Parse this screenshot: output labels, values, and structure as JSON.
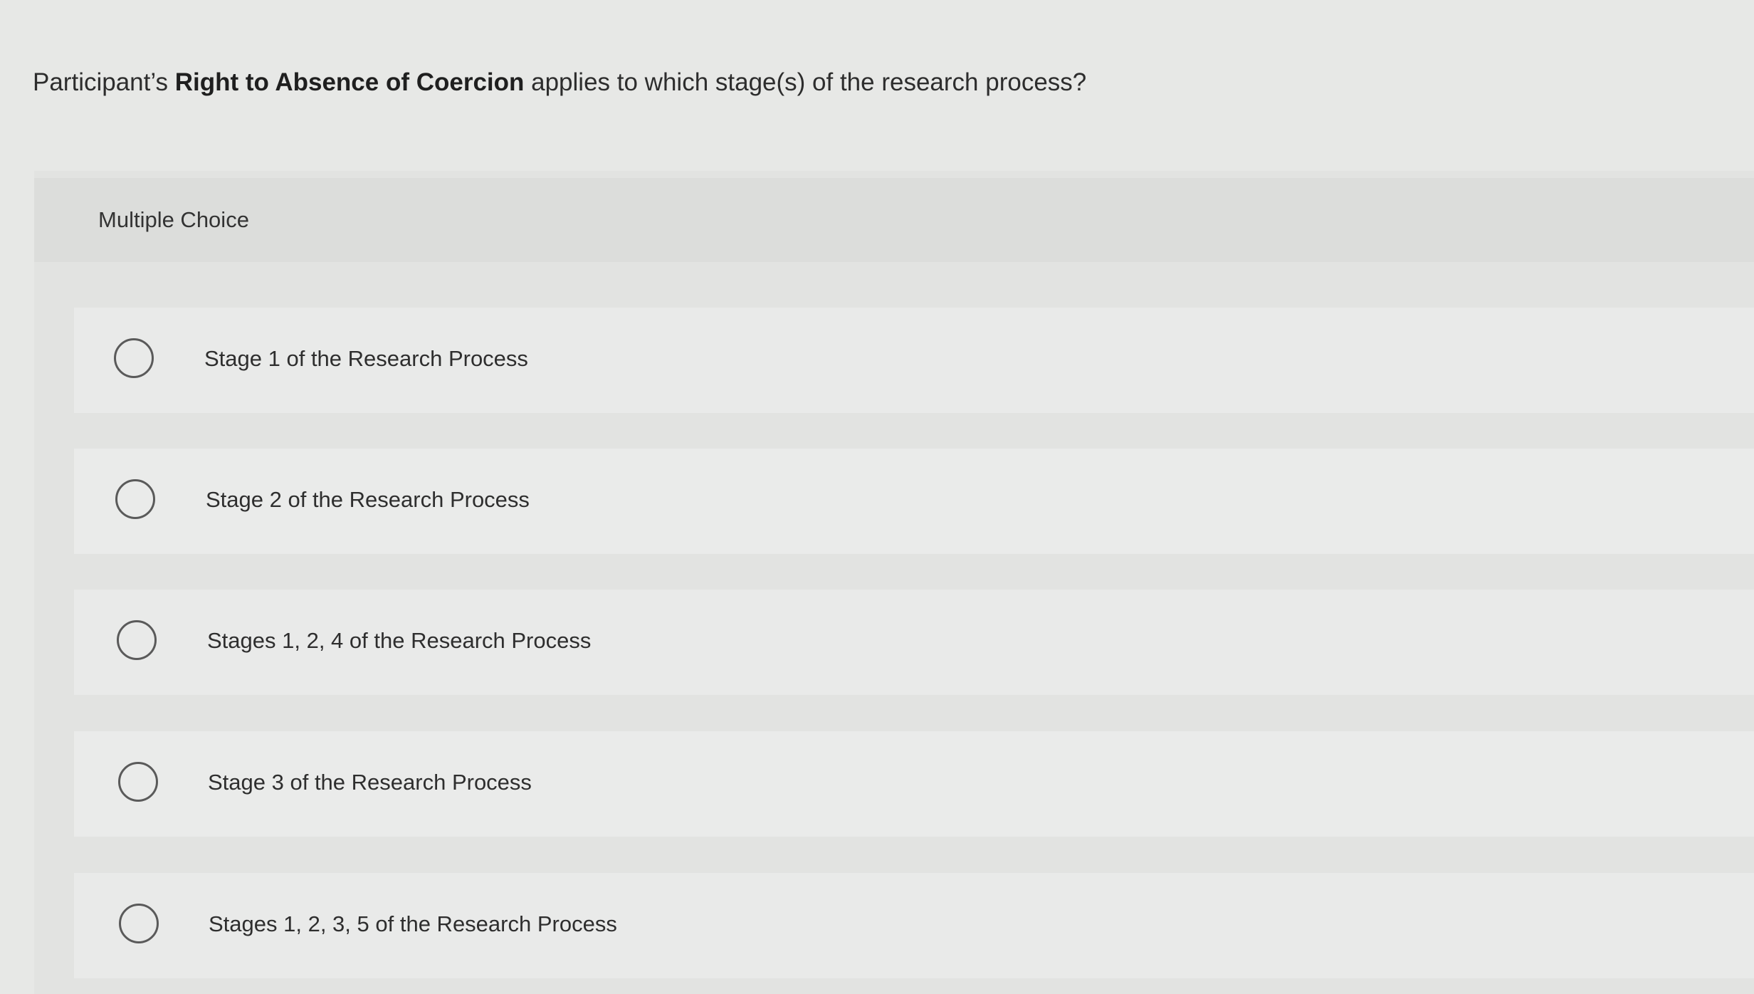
{
  "question": {
    "prefix": "Participant’s ",
    "bold": "Right to Absence of Coercion",
    "suffix": " applies to which stage(s) of the research process?"
  },
  "question_type": "Multiple Choice",
  "options": [
    {
      "label": "Stage 1 of the Research Process",
      "selected": false
    },
    {
      "label": "Stage 2 of the Research Process",
      "selected": false
    },
    {
      "label": "Stages 1, 2, 4 of the Research Process",
      "selected": false
    },
    {
      "label": "Stage 3 of the Research Process",
      "selected": false
    },
    {
      "label": "Stages 1, 2, 3, 5 of the Research Process",
      "selected": false
    }
  ]
}
